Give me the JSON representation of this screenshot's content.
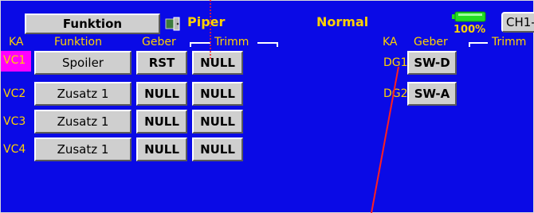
{
  "header": {
    "function_tab": "Funktion",
    "model_icon": "door-icon",
    "model_name": "Piper",
    "mode": "Normal",
    "battery_percent": "100%",
    "channel_button": "CH1-"
  },
  "headers": {
    "ka": "KA",
    "funktion": "Funktion",
    "geber": "Geber",
    "trimm": "Trimm",
    "ka_right": "KA",
    "geber_right": "Geber",
    "trimm_right": "Trimm"
  },
  "rows": [
    {
      "ka": "VC1",
      "funktion": "Spoiler",
      "geber": "RST",
      "trimm": "NULL"
    },
    {
      "ka": "VC2",
      "funktion": "Zusatz 1",
      "geber": "NULL",
      "trimm": "NULL"
    },
    {
      "ka": "VC3",
      "funktion": "Zusatz 1",
      "geber": "NULL",
      "trimm": "NULL"
    },
    {
      "ka": "VC4",
      "funktion": "Zusatz 1",
      "geber": "NULL",
      "trimm": "NULL"
    }
  ],
  "right_rows": [
    {
      "ka": "DG1",
      "geber": "SW-D"
    },
    {
      "ka": "DG2",
      "geber": "SW-A"
    }
  ],
  "colors": {
    "background": "#0a0ae6",
    "label": "#ffd200",
    "selected": "#ff00ff",
    "button": "#cfcfcf",
    "battery": "#22dd22",
    "annotation_line": "#ff2020"
  }
}
